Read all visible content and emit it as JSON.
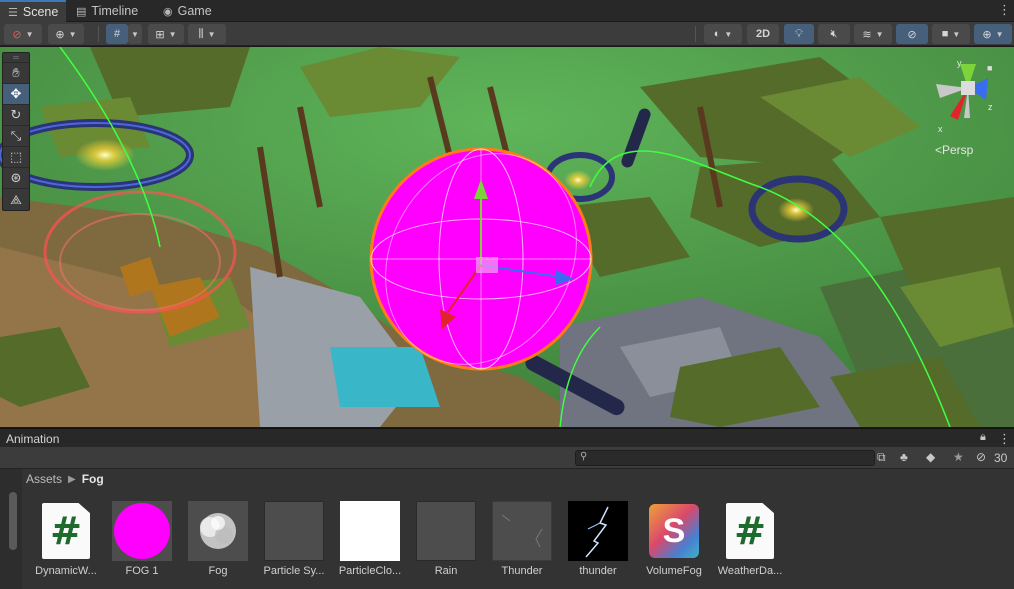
{
  "tabs": [
    {
      "label": "Scene",
      "icon": "scene-grid-icon",
      "active": true
    },
    {
      "label": "Timeline",
      "icon": "timeline-icon",
      "active": false
    },
    {
      "label": "Game",
      "icon": "gamepad-icon",
      "active": false
    }
  ],
  "toolbar": {
    "mode_2d_label": "2D"
  },
  "scene_view": {
    "camera_mode_label": "<Persp",
    "gizmo_axes": {
      "x": "x",
      "y": "y",
      "z": "z"
    }
  },
  "animation_panel": {
    "title": "Animation",
    "hidden_count": "30",
    "search_placeholder": ""
  },
  "breadcrumb": {
    "root": "Assets",
    "current": "Fog"
  },
  "assets": [
    {
      "name": "DynamicW...",
      "kind": "csharp-script"
    },
    {
      "name": "FOG 1",
      "kind": "material-magenta"
    },
    {
      "name": "Fog",
      "kind": "texture-cloud"
    },
    {
      "name": "Particle Sy...",
      "kind": "particle-system"
    },
    {
      "name": "ParticleClo...",
      "kind": "material-white"
    },
    {
      "name": "Rain",
      "kind": "particle-system"
    },
    {
      "name": "Thunder",
      "kind": "particle-system-cracks"
    },
    {
      "name": "thunder",
      "kind": "texture-lightning"
    },
    {
      "name": "VolumeFog",
      "kind": "shader-s"
    },
    {
      "name": "WeatherDa...",
      "kind": "csharp-script"
    }
  ],
  "colors": {
    "accent_blue": "#3a79bb",
    "selection_blue": "#46607c",
    "magenta_material": "#ff00ff",
    "script_hash_green": "#1f6b2d"
  }
}
